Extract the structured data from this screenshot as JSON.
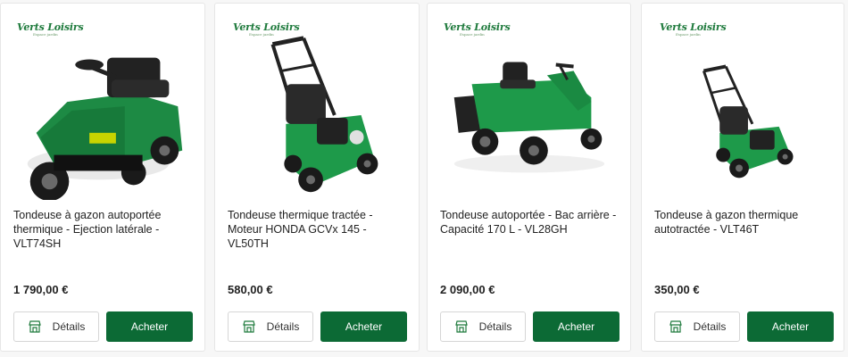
{
  "brand": {
    "name": "Verts Loisirs",
    "tagline": "Espace jardin"
  },
  "colors": {
    "accent": "#0c6a35",
    "product_green": "#1e9a4a",
    "border": "#e6e6e6"
  },
  "products": [
    {
      "title": "Tondeuse à gazon autoportée thermique - Ejection latérale - VLT74SH",
      "price": "1 790,00 €",
      "details_label": "Détails",
      "buy_label": "Acheter",
      "details_icon": "storefront-icon"
    },
    {
      "title": "Tondeuse thermique tractée - Moteur HONDA GCVx 145 - VL50TH",
      "price": "580,00 €",
      "details_label": "Détails",
      "buy_label": "Acheter",
      "details_icon": "storefront-icon"
    },
    {
      "title": "Tondeuse autoportée - Bac arrière - Capacité 170 L - VL28GH",
      "price": "2 090,00 €",
      "details_label": "Détails",
      "buy_label": "Acheter",
      "details_icon": "storefront-icon"
    },
    {
      "title": "Tondeuse à gazon thermique autotractée - VLT46T",
      "price": "350,00 €",
      "details_label": "Détails",
      "buy_label": "Acheter",
      "details_icon": "storefront-icon"
    }
  ]
}
